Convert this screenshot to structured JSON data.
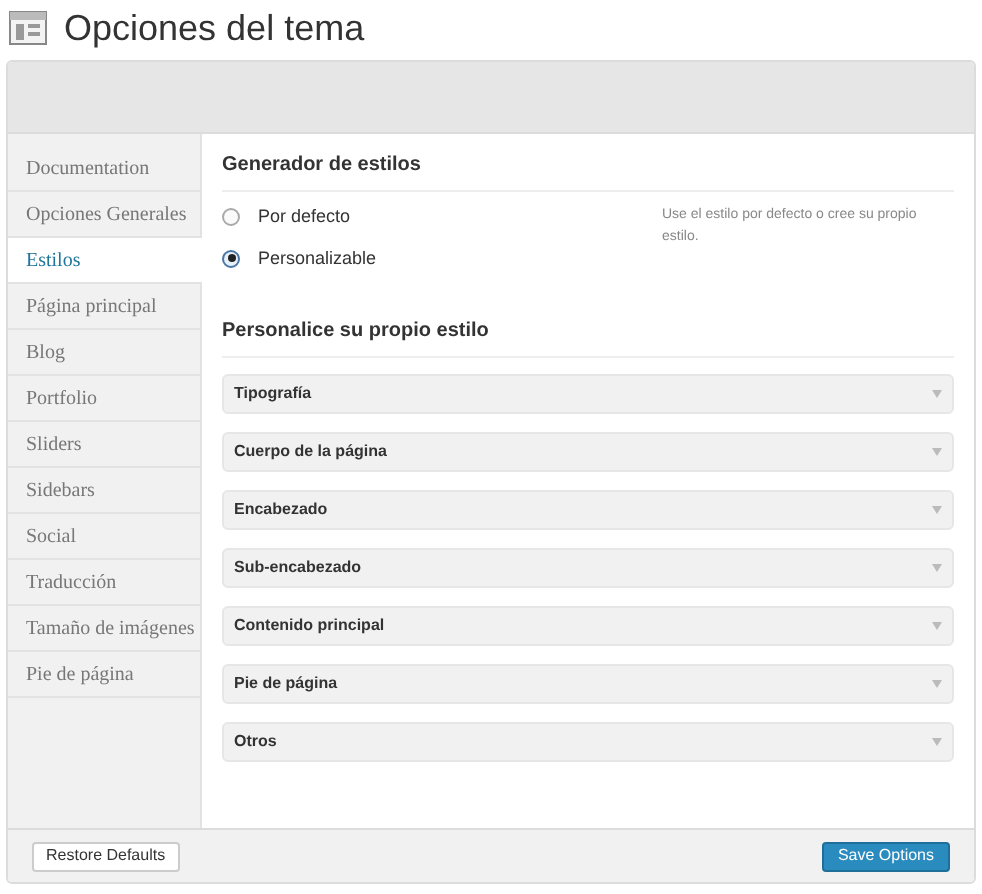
{
  "page": {
    "title": "Opciones del tema"
  },
  "sidebar": {
    "items": [
      {
        "label": "Documentation",
        "selected": false
      },
      {
        "label": "Opciones Generales",
        "selected": false
      },
      {
        "label": "Estilos",
        "selected": true
      },
      {
        "label": "Página principal",
        "selected": false
      },
      {
        "label": "Blog",
        "selected": false
      },
      {
        "label": "Portfolio",
        "selected": false
      },
      {
        "label": "Sliders",
        "selected": false
      },
      {
        "label": "Sidebars",
        "selected": false
      },
      {
        "label": "Social",
        "selected": false
      },
      {
        "label": "Traducción",
        "selected": false
      },
      {
        "label": "Tamaño de imágenes",
        "selected": false
      },
      {
        "label": "Pie de página",
        "selected": false
      }
    ]
  },
  "style_generator": {
    "heading": "Generador de estilos",
    "options": [
      {
        "label": "Por defecto",
        "selected": false
      },
      {
        "label": "Personalizable",
        "selected": true
      }
    ],
    "help": "Use el estilo por defecto o cree su propio estilo."
  },
  "customize": {
    "heading": "Personalice su propio estilo",
    "sections": [
      {
        "label": "Tipografía",
        "expanded": false
      },
      {
        "label": "Cuerpo de la página",
        "expanded": false
      },
      {
        "label": "Encabezado",
        "expanded": false
      },
      {
        "label": "Sub-encabezado",
        "expanded": false
      },
      {
        "label": "Contenido principal",
        "expanded": false
      },
      {
        "label": "Pie de página",
        "expanded": false
      },
      {
        "label": "Otros",
        "expanded": false
      }
    ]
  },
  "footer": {
    "restore": "Restore Defaults",
    "save": "Save Options"
  }
}
